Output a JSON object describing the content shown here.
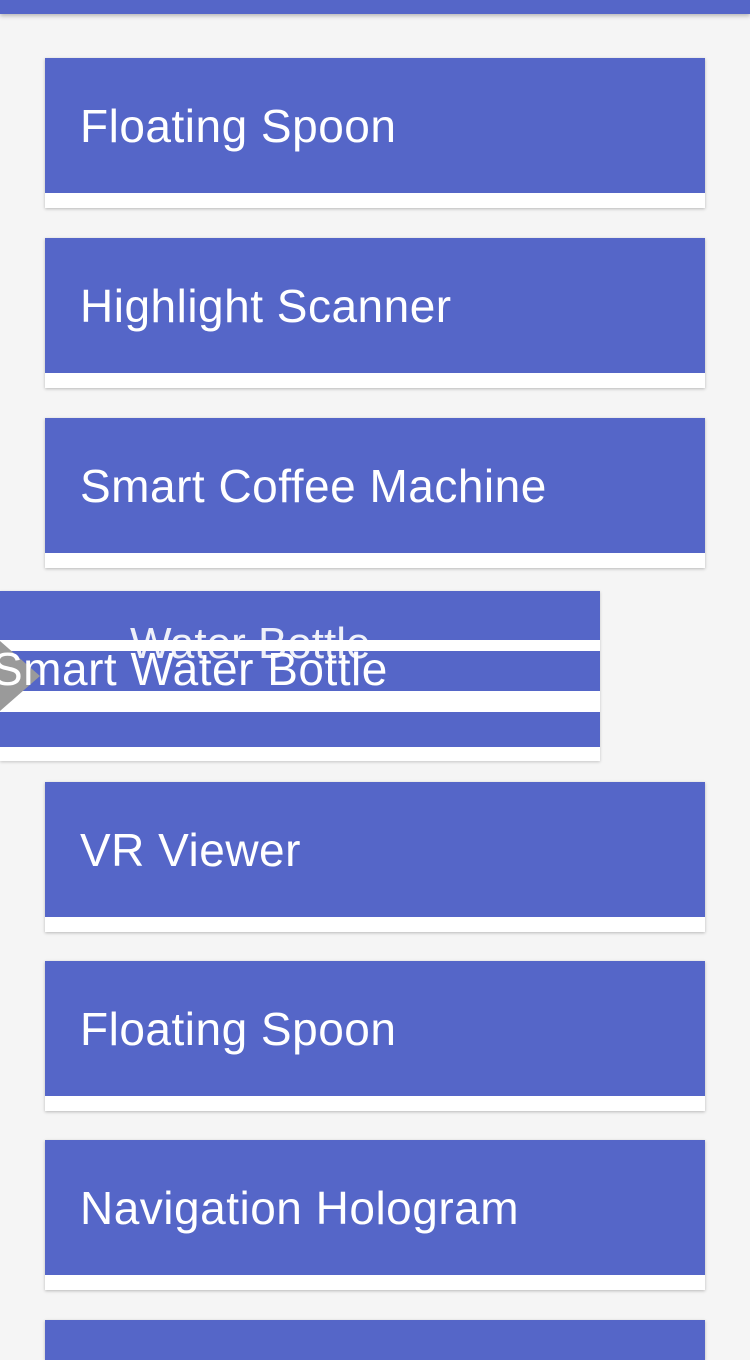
{
  "list": {
    "items": [
      {
        "label": "Floating Spoon"
      },
      {
        "label": "Highlight Scanner"
      },
      {
        "label": "Smart Coffee Machine"
      },
      {
        "label": "VR Viewer"
      },
      {
        "label": "Floating Spoon"
      },
      {
        "label": "Navigation Hologram"
      }
    ],
    "dragging": {
      "label": "Smart Water Bottle",
      "under_label": "Water Bottle"
    }
  },
  "colors": {
    "accent": "#5566c8",
    "card": "#ffffff",
    "background": "#f5f5f5"
  }
}
